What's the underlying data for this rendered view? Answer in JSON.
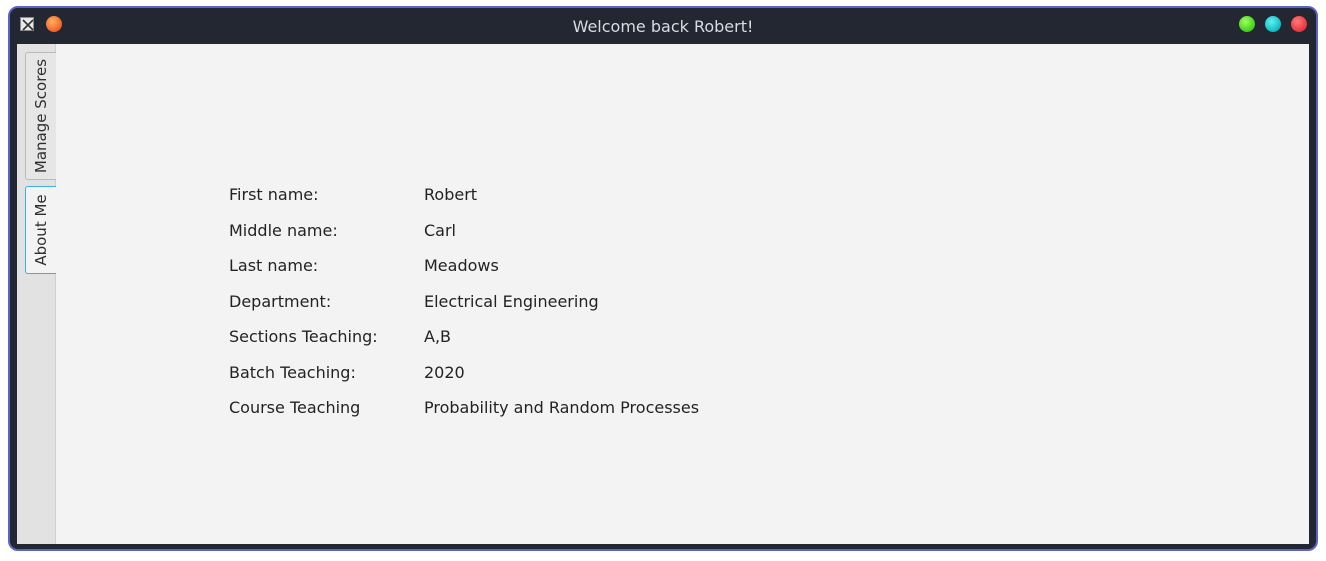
{
  "window": {
    "title": "Welcome back Robert!"
  },
  "tabs": [
    {
      "label": "Manage Scores",
      "active": false
    },
    {
      "label": "About Me",
      "active": true
    }
  ],
  "profile": {
    "rows": [
      {
        "label": "First name:",
        "value": "Robert"
      },
      {
        "label": "Middle name:",
        "value": "Carl"
      },
      {
        "label": "Last name:",
        "value": "Meadows"
      },
      {
        "label": "Department:",
        "value": "Electrical Engineering"
      },
      {
        "label": "Sections Teaching:",
        "value": "A,B"
      },
      {
        "label": "Batch Teaching:",
        "value": "2020"
      },
      {
        "label": "Course Teaching",
        "value": "Probability and Random Processes"
      }
    ]
  },
  "icons": {
    "app": "x11-app-icon",
    "menu_orb": "window-menu-orb-icon",
    "minimize": "minimize-icon",
    "maximize": "maximize-icon",
    "close": "close-icon"
  },
  "colors": {
    "titlebar": "#232731",
    "frame_border": "#5b63c9",
    "client_background": "#f3f3f3",
    "active_tab_border": "#3daee9",
    "minimize": "#3fce1d",
    "maximize": "#10b9c3",
    "close": "#e8333c"
  }
}
